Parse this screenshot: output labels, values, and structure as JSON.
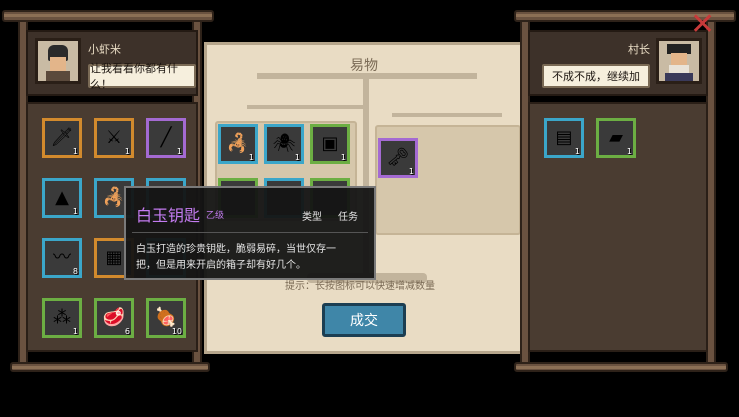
{
  "left": {
    "player_name": "小虾米",
    "player_speech": "让我看看你都有什么！",
    "items": [
      {
        "icon": "sword-icon",
        "glyph": "🗡",
        "rarity": "orange",
        "count": "1"
      },
      {
        "icon": "halberd-icon",
        "glyph": "⚔",
        "rarity": "orange",
        "count": "1"
      },
      {
        "icon": "staff-icon",
        "glyph": "╱",
        "rarity": "purple",
        "count": "1"
      },
      {
        "icon": "powder-icon",
        "glyph": "▲",
        "rarity": "blue",
        "count": "1"
      },
      {
        "icon": "scorpion-icon",
        "glyph": "🦂",
        "rarity": "blue",
        "count": ""
      },
      {
        "icon": "item-icon",
        "glyph": "",
        "rarity": "blue",
        "count": ""
      },
      {
        "icon": "centipede-icon",
        "glyph": "〰",
        "rarity": "blue",
        "count": "8"
      },
      {
        "icon": "cloth-icon",
        "glyph": "▦",
        "rarity": "orange",
        "count": ""
      },
      {
        "icon": "item-icon",
        "glyph": "",
        "rarity": "blue",
        "count": ""
      },
      {
        "icon": "seeds-icon",
        "glyph": "⁂",
        "rarity": "green",
        "count": "1"
      },
      {
        "icon": "meat-icon",
        "glyph": "🥩",
        "rarity": "green",
        "count": "6"
      },
      {
        "icon": "raw-meat-icon",
        "glyph": "🍖",
        "rarity": "green",
        "count": "10"
      }
    ]
  },
  "center": {
    "title": "易物",
    "hint": "提示：长按图标可以快速增减数量",
    "trade_button": "成交",
    "player_offer": [
      {
        "icon": "scorpion-icon",
        "glyph": "🦂",
        "rarity": "blue",
        "count": "1"
      },
      {
        "icon": "spider-icon",
        "glyph": "🕷",
        "rarity": "blue",
        "count": "1"
      },
      {
        "icon": "armor-icon",
        "glyph": "▣",
        "rarity": "green",
        "count": "1"
      },
      {
        "icon": "item-icon",
        "glyph": "",
        "rarity": "green",
        "count": ""
      },
      {
        "icon": "item-icon",
        "glyph": "",
        "rarity": "blue",
        "count": ""
      },
      {
        "icon": "item-icon",
        "glyph": "",
        "rarity": "green",
        "count": ""
      }
    ],
    "npc_offer": [
      {
        "icon": "key-icon",
        "glyph": "🗝",
        "rarity": "purple",
        "count": "1"
      }
    ]
  },
  "tooltip": {
    "item_name": "白玉钥匙",
    "grade": "乙级",
    "type_label": "类型",
    "type_value": "任务",
    "description_line1": "白玉打造的珍贵钥匙，脆弱易碎，当世仅存一",
    "description_line2": "把，但是用来开启的箱子却有好几个。"
  },
  "right": {
    "npc_name": "村长",
    "npc_speech": "不成不成，继续加",
    "items": [
      {
        "icon": "scroll-icon",
        "glyph": "▤",
        "rarity": "blue",
        "count": "1"
      },
      {
        "icon": "ingot-icon",
        "glyph": "▰",
        "rarity": "green",
        "count": "1"
      }
    ]
  },
  "colors": {
    "orange": "#d28a2d",
    "blue": "#3ba6c9",
    "purple": "#a46ad2",
    "green": "#6cae43",
    "tooltip_name": "#c37bf0",
    "close": "#c73a3a"
  }
}
